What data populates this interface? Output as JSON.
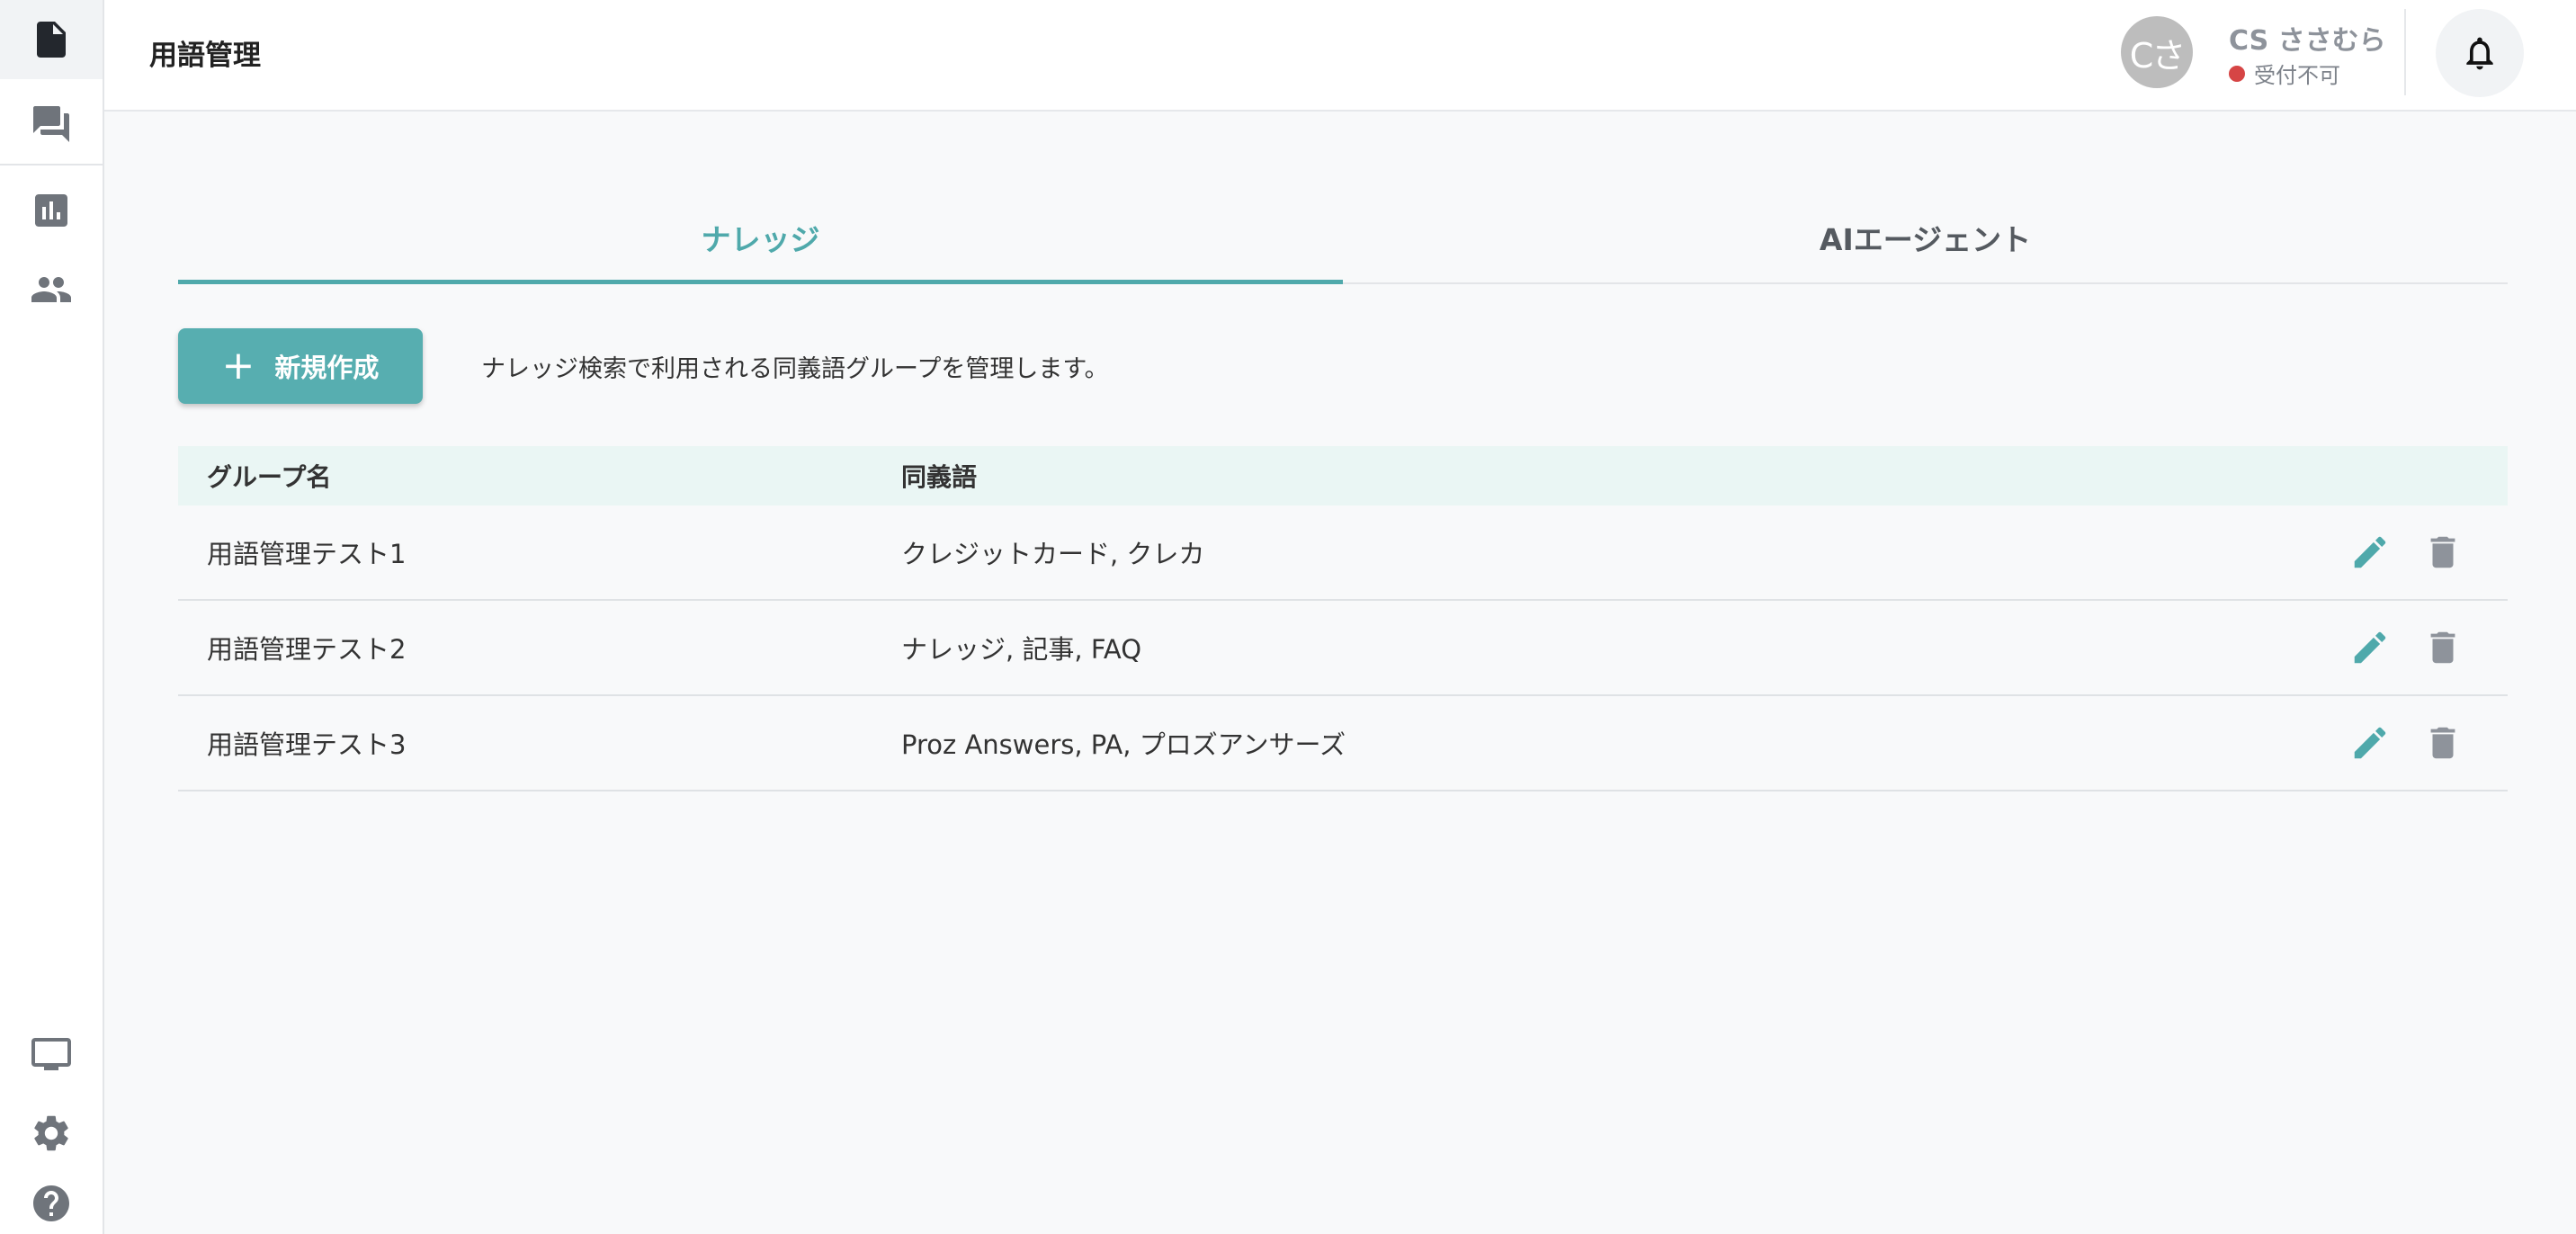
{
  "colors": {
    "accent": "#4fa9ab",
    "button": "#57aeb0",
    "table_header_bg": "#eaf6f4",
    "status_unavailable": "#d64545",
    "icon_gray": "#8e939b"
  },
  "sidebar": {
    "items": [
      {
        "icon": "document-icon",
        "active": true
      },
      {
        "icon": "chat-icon",
        "active": false
      },
      {
        "icon": "bar-chart-icon",
        "active": false
      },
      {
        "icon": "people-icon",
        "active": false
      },
      {
        "icon": "monitor-icon",
        "active": false
      },
      {
        "icon": "gear-icon",
        "active": false
      },
      {
        "icon": "help-icon",
        "active": false
      }
    ]
  },
  "header": {
    "title": "用語管理",
    "user": {
      "avatar_text": "Cさ",
      "name": "CS ささむら",
      "status": "受付不可"
    },
    "notification_icon": "bell-icon"
  },
  "tabs": [
    {
      "label": "ナレッジ",
      "active": true
    },
    {
      "label": "AIエージェント",
      "active": false
    }
  ],
  "actions": {
    "new_button_label": "新規作成",
    "new_button_icon": "plus-icon",
    "description": "ナレッジ検索で利用される同義語グループを管理します。"
  },
  "table": {
    "columns": [
      "グループ名",
      "同義語"
    ],
    "rows": [
      {
        "group": "用語管理テスト1",
        "synonyms": "クレジットカード, クレカ"
      },
      {
        "group": "用語管理テスト2",
        "synonyms": "ナレッジ, 記事, FAQ"
      },
      {
        "group": "用語管理テスト3",
        "synonyms": "Proz Answers, PA, プロズアンサーズ"
      }
    ],
    "row_actions": [
      "edit-icon",
      "trash-icon"
    ]
  }
}
